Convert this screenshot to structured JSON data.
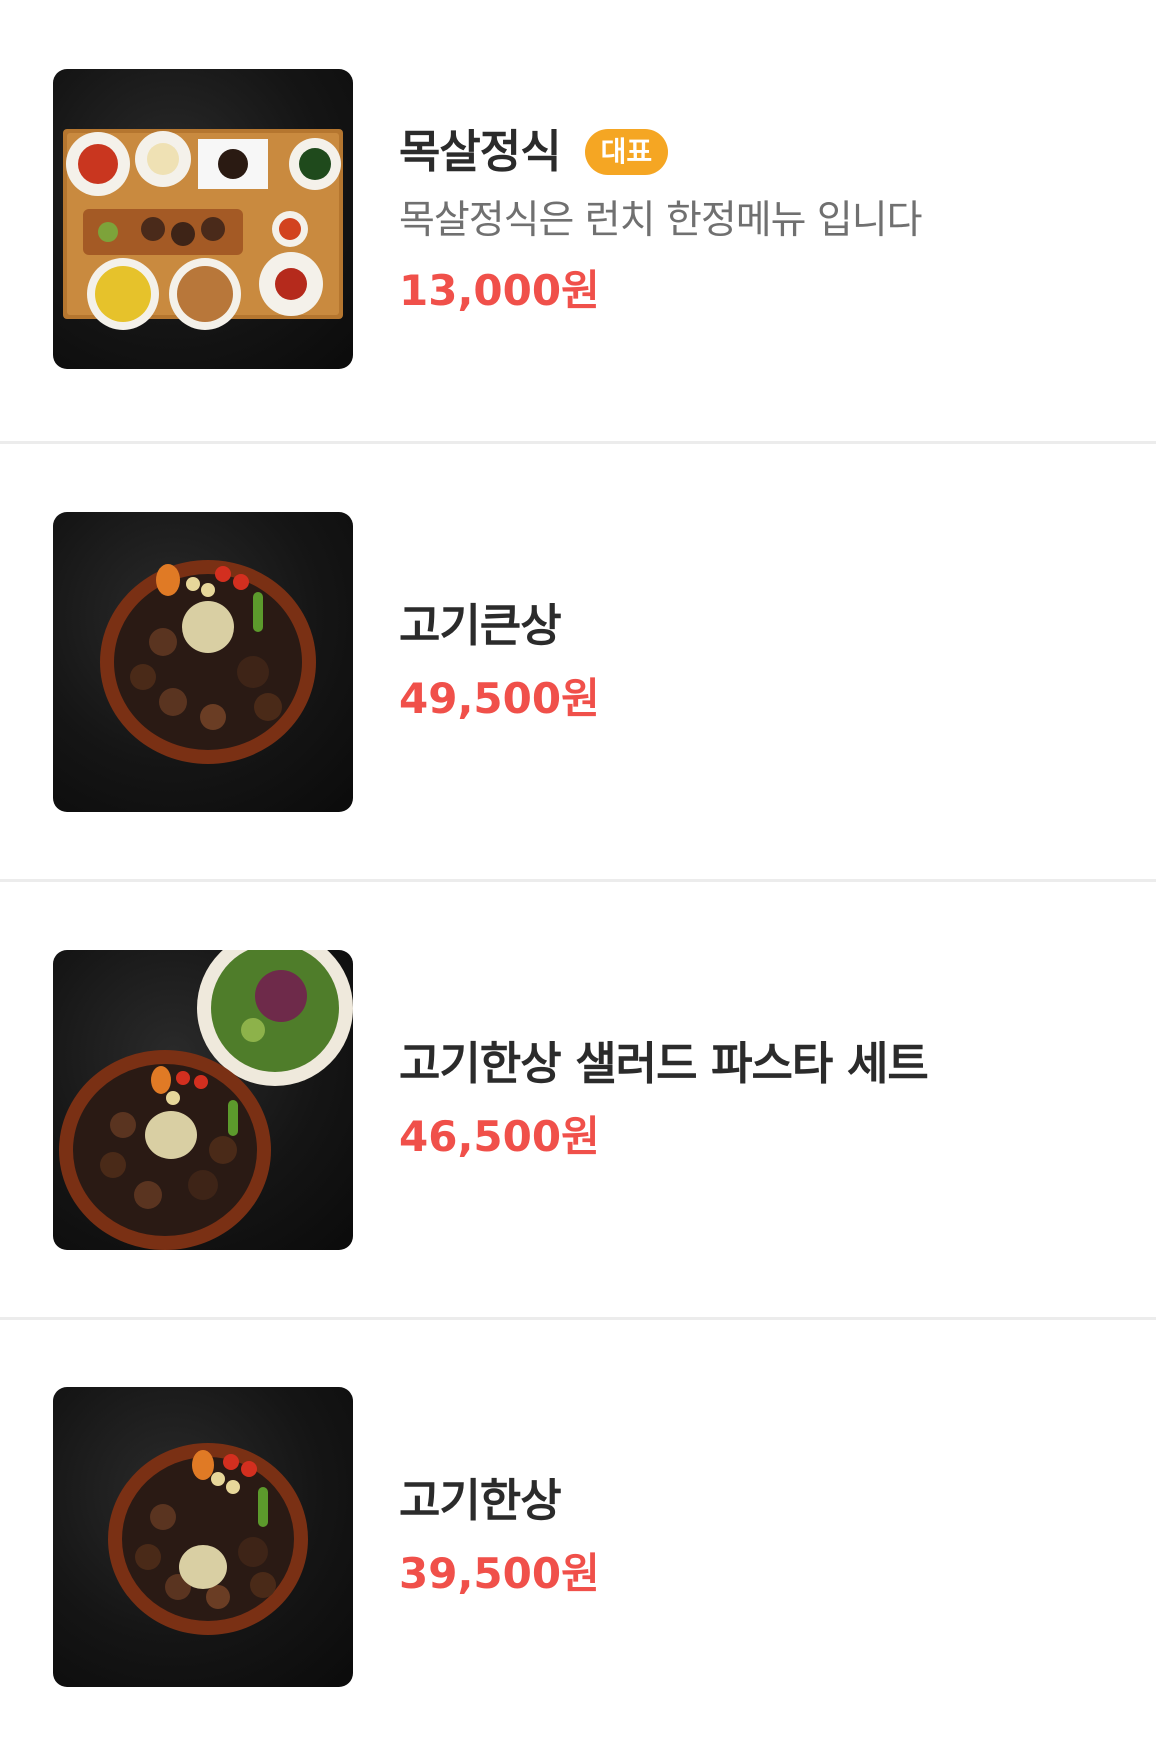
{
  "menu": {
    "items": [
      {
        "name": "목살정식",
        "badge": "대표",
        "description": "목살정식은 런치 한정메뉴 입니다",
        "price": "13,000원",
        "image_icon": "set-meal-photo"
      },
      {
        "name": "고기큰상",
        "price": "49,500원",
        "image_icon": "grilled-meat-platter-photo"
      },
      {
        "name": "고기한상 샐러드 파스타 세트",
        "price": "46,500원",
        "image_icon": "meat-salad-set-photo"
      },
      {
        "name": "고기한상",
        "price": "39,500원",
        "image_icon": "grilled-meat-platter-photo"
      }
    ]
  },
  "colors": {
    "price": "#f0504a",
    "badge": "#f5a623",
    "divider": "#ececec"
  }
}
